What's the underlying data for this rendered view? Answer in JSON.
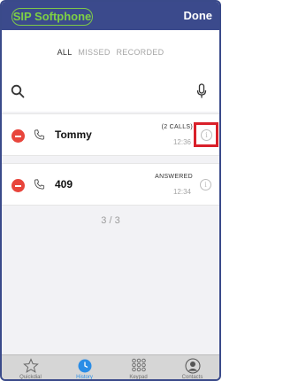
{
  "header": {
    "app_title": "SIP Softphone",
    "done_label": "Done"
  },
  "filters": {
    "all": "ALL",
    "missed": "MISSED",
    "recorded": "RECORDED",
    "active": "ALL"
  },
  "calls": [
    {
      "name": "Tommy",
      "status": "(2 CALLS)",
      "time": "12:36",
      "info_icon": "info-icon"
    },
    {
      "name": "409",
      "status": "ANSWERED",
      "time": "12:34",
      "info_icon": "info-icon"
    }
  ],
  "pager": {
    "text": "3 / 3"
  },
  "tabs": [
    {
      "label": "Quickdial",
      "icon": "star-icon"
    },
    {
      "label": "History",
      "icon": "clock-icon",
      "active": true
    },
    {
      "label": "Keypad",
      "icon": "keypad-icon"
    },
    {
      "label": "Contacts",
      "icon": "contact-icon"
    }
  ],
  "colors": {
    "header_bg": "#3b4a8c",
    "brand_green": "#7ed044",
    "delete_red": "#e8453c",
    "highlight_red": "#d9202a",
    "active_tab": "#2b8de6"
  }
}
